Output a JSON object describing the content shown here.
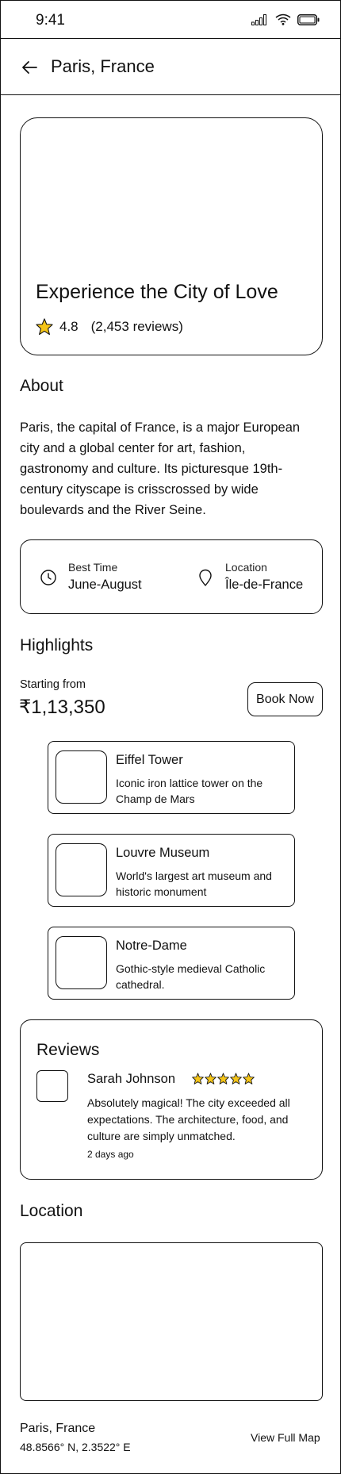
{
  "status_bar": {
    "time": "9:41",
    "icons": [
      "signal-icon",
      "wifi-icon",
      "battery-icon"
    ]
  },
  "header": {
    "title": "Paris, France",
    "back_icon": "arrow-left-icon"
  },
  "hero": {
    "title": "Experience the City of Love",
    "rating": "4.8",
    "reviews": "(2,453 reviews)",
    "star_color": "#f5c518"
  },
  "about": {
    "title": "About",
    "text": "Paris, the capital of France, is a major European city and a global center for art, fashion, gastronomy and culture. Its picturesque 19th-century cityscape is crisscrossed by wide boulevards and the River Seine."
  },
  "info": {
    "best_time_label": "Best Time",
    "best_time_value": "June-August",
    "location_label": "Location",
    "location_value": "Île-de-France"
  },
  "highlights": {
    "title": "Highlights",
    "price_label": "Starting from",
    "price_value": "₹1,13,350",
    "book_label": "Book Now",
    "items": [
      {
        "name": "Eiffel Tower",
        "desc": "Iconic iron lattice tower on the Champ de Mars"
      },
      {
        "name": "Louvre Museum",
        "desc": "World's largest art museum and historic monument"
      },
      {
        "name": "Notre-Dame",
        "desc": "Gothic-style medieval Catholic cathedral."
      }
    ]
  },
  "reviews": {
    "title": "Reviews",
    "items": [
      {
        "name": "Sarah Johnson",
        "stars": 5,
        "text": "Absolutely magical! The city exceeded all expectations. The architecture, food, and culture are simply unmatched.",
        "time": "2 days ago"
      }
    ]
  },
  "location": {
    "title": "Location",
    "name": "Paris, France",
    "coords": "48.8566° N, 2.3522° E",
    "view_map": "View Full Map"
  }
}
